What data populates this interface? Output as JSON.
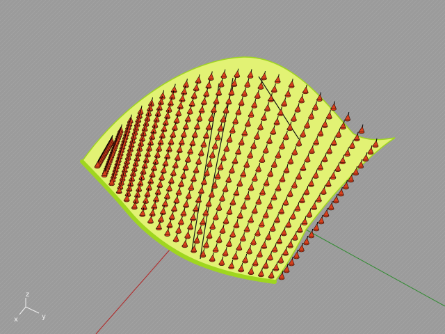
{
  "viewport": {
    "background_color": "#9b9b9b",
    "grid_color": "#a6a6a6",
    "x_axis_color": "#b22222",
    "y_axis_color": "#2e8b2e"
  },
  "surface": {
    "fill_color": "#e2f274",
    "edge_color": "#9fd61f",
    "isocurve_color": "#111111"
  },
  "markers": {
    "cone_color": "#d9401c",
    "cone_edge_color": "#2a0d06",
    "normal_color": "#000000"
  },
  "axis_gizmo": {
    "x_label": "x",
    "y_label": "y",
    "z_label": "z",
    "color": "#f2f2f2"
  }
}
